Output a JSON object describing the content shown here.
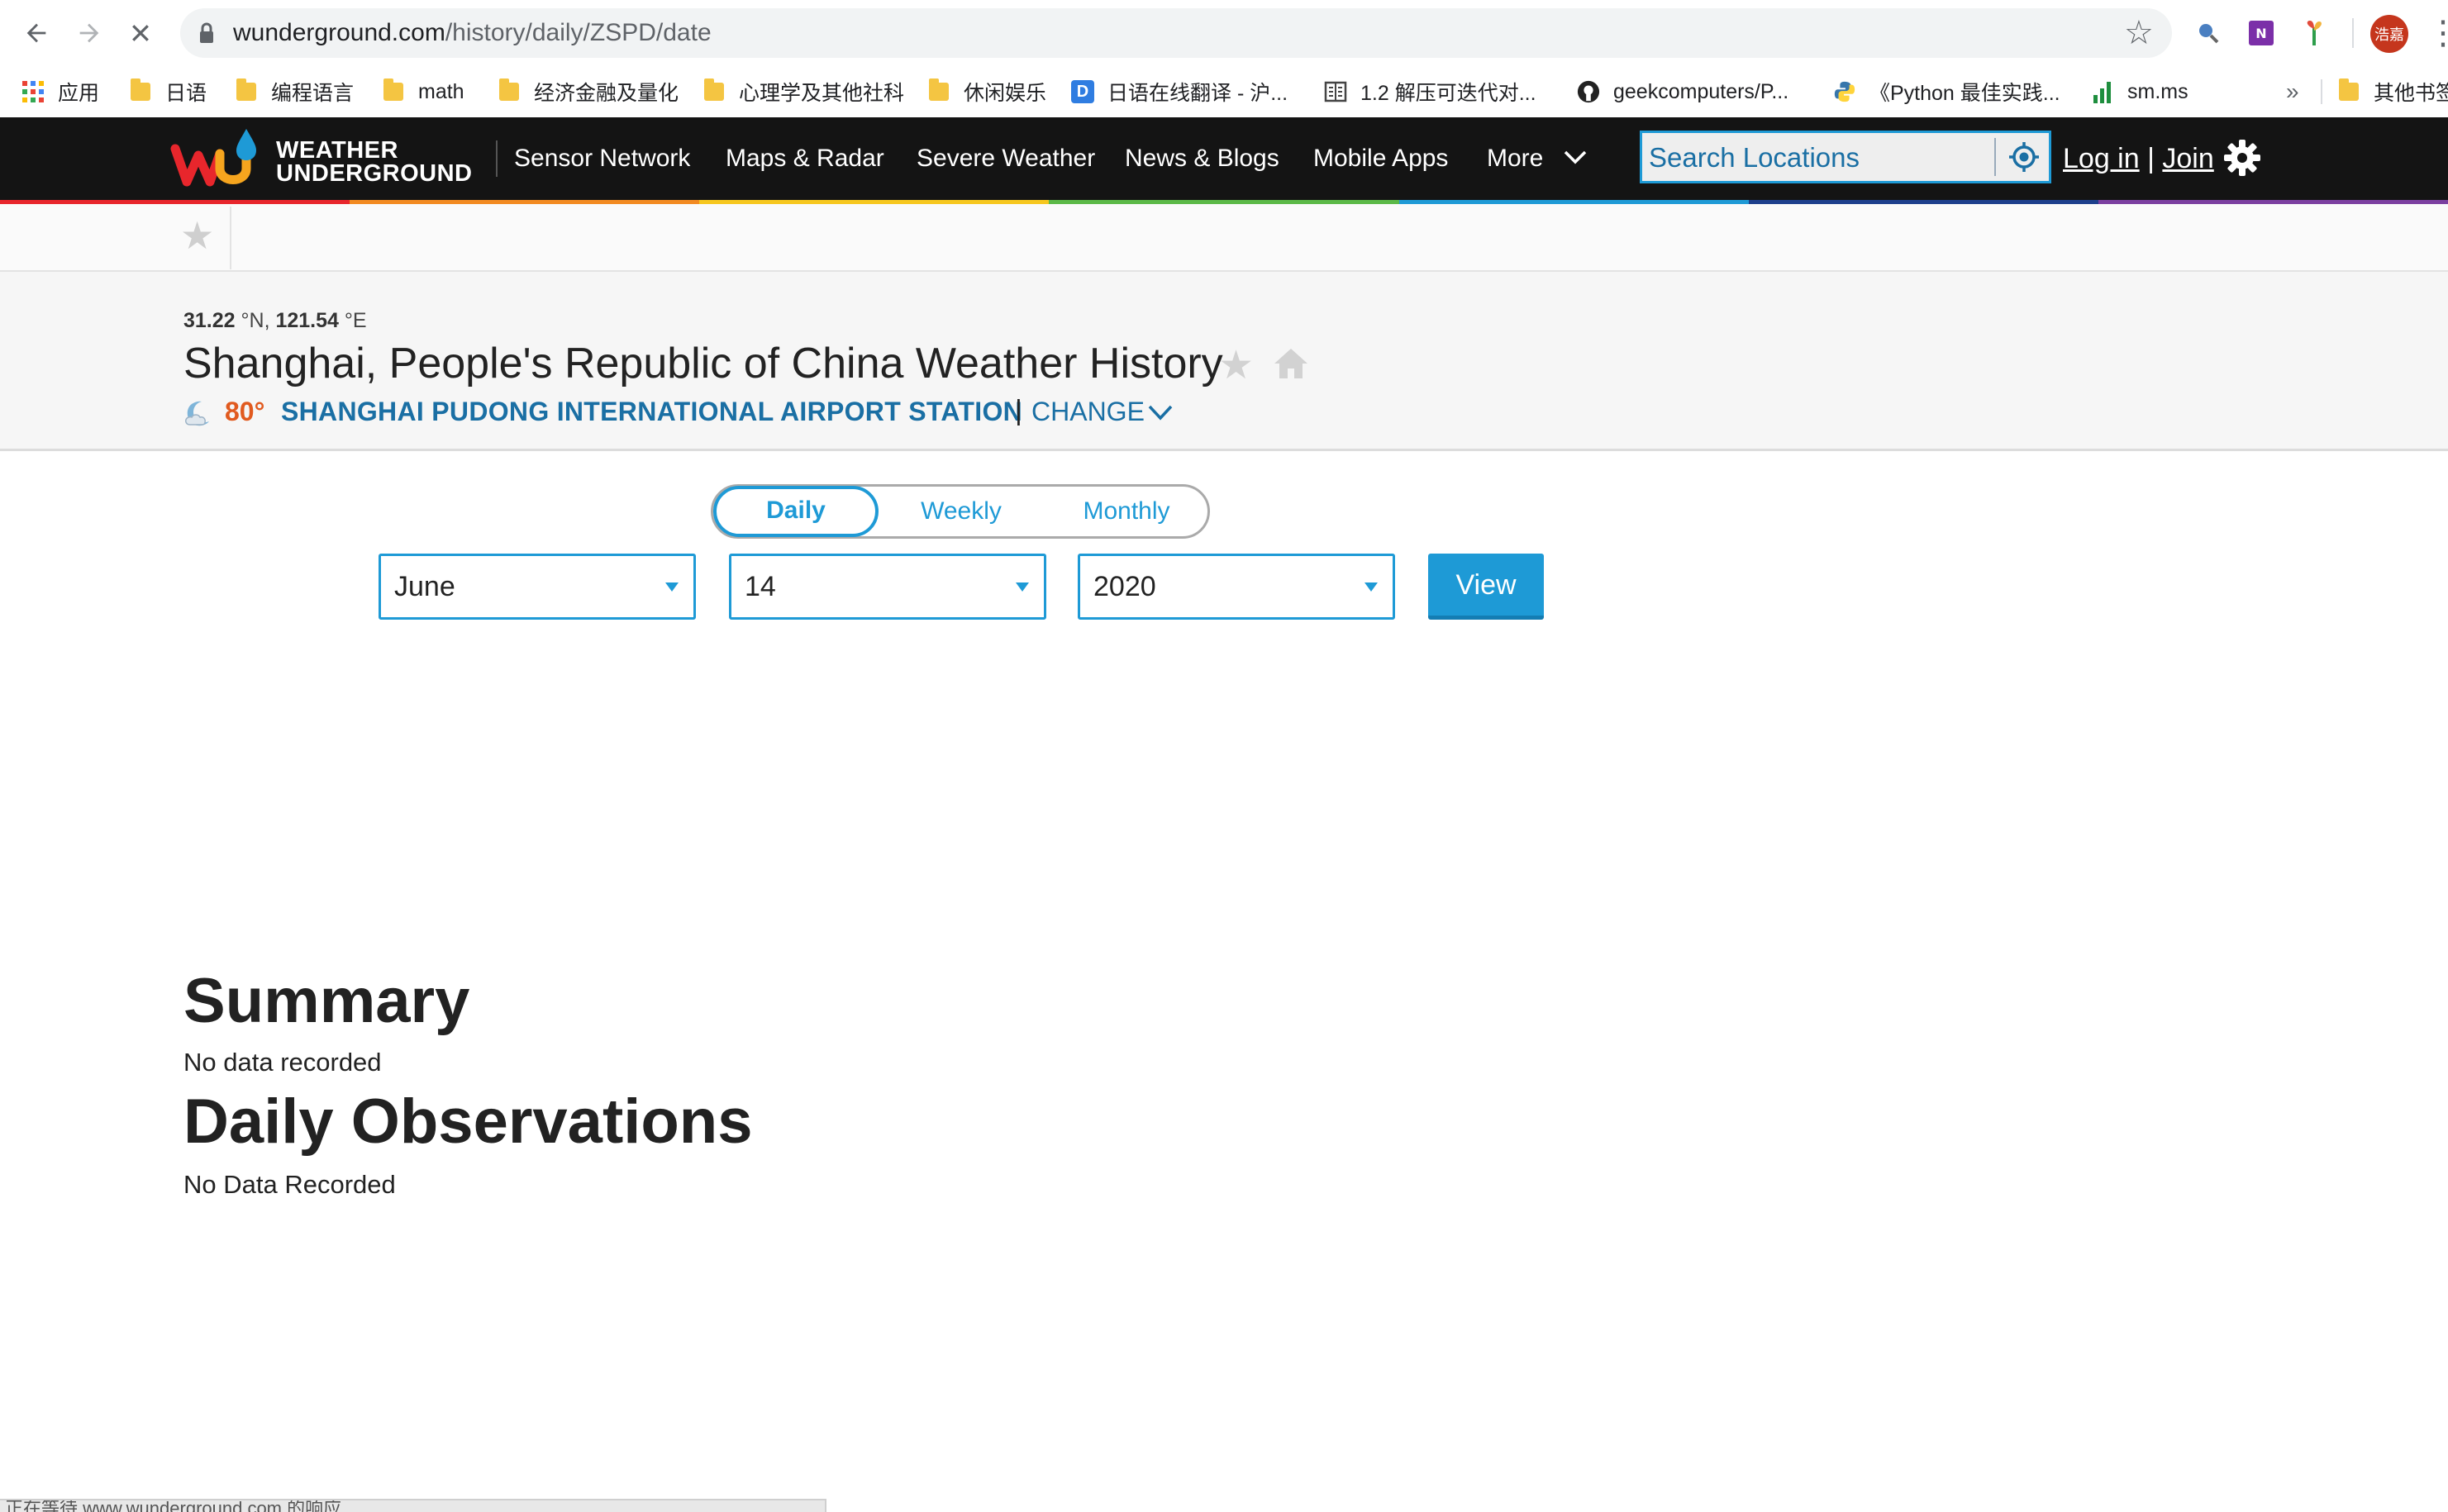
{
  "browser": {
    "url_domain": "wunderground.com",
    "url_path": "/history/daily/ZSPD/date",
    "bookmarks": [
      {
        "label": "应用",
        "icon": "apps-grid-icon"
      },
      {
        "label": "日语",
        "icon": "folder-icon"
      },
      {
        "label": "编程语言",
        "icon": "folder-icon"
      },
      {
        "label": "math",
        "icon": "folder-icon"
      },
      {
        "label": "经济金融及量化",
        "icon": "folder-icon"
      },
      {
        "label": "心理学及其他社科",
        "icon": "folder-icon"
      },
      {
        "label": "休闲娱乐",
        "icon": "folder-icon"
      },
      {
        "label": "日语在线翻译 - 沪...",
        "icon": "translate-d-icon"
      },
      {
        "label": "1.2 解压可迭代对...",
        "icon": "book-icon"
      },
      {
        "label": "geekcomputers/P...",
        "icon": "github-icon"
      },
      {
        "label": "《Python 最佳实践...",
        "icon": "python-icon"
      },
      {
        "label": "sm.ms",
        "icon": "bar-chart-icon"
      }
    ],
    "bookmarks_overflow": "»",
    "other_bookmarks": "其他书签",
    "profile_initials": "浩嘉",
    "status_text": "正在等待 www.wunderground.com 的响应..."
  },
  "wu": {
    "logo_line1": "WEATHER",
    "logo_line2": "UNDERGROUND",
    "nav": [
      "Sensor Network",
      "Maps & Radar",
      "Severe Weather",
      "News & Blogs",
      "Mobile Apps",
      "More"
    ],
    "search_placeholder": "Search Locations",
    "login": "Log in",
    "separator": "|",
    "join": "Join"
  },
  "location": {
    "lat": "31.22",
    "lat_unit": "°N,",
    "lon": "121.54",
    "lon_unit": "°E",
    "title": "Shanghai, People's Republic of China Weather History",
    "temperature": "80°",
    "station": "SHANGHAI PUDONG INTERNATIONAL AIRPORT STATION",
    "separator": "|",
    "change": "CHANGE"
  },
  "history": {
    "tabs": [
      "Daily",
      "Weekly",
      "Monthly"
    ],
    "active_tab": "Daily",
    "month": "June",
    "day": "14",
    "year": "2020",
    "view_button": "View"
  },
  "summary": {
    "title": "Summary",
    "text": "No data recorded"
  },
  "observations": {
    "title": "Daily Observations",
    "text": "No Data Recorded"
  },
  "colors": {
    "wu_nav_bg": "#141414",
    "accent_blue": "#1e9ad6",
    "link_blue": "#1a6fa4",
    "temp_orange": "#e15a1f",
    "rainbow": [
      "#e8262c",
      "#f28a21",
      "#f6c71e",
      "#5bb947",
      "#1e9ad6",
      "#1d3f8c",
      "#7b3fa0"
    ]
  }
}
